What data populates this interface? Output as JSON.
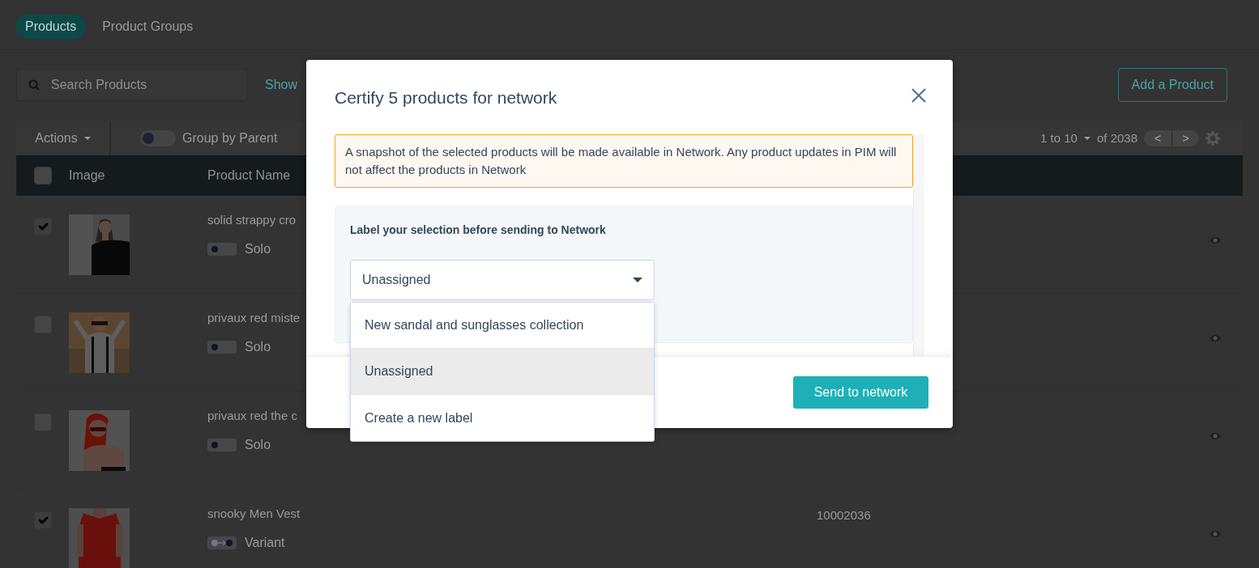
{
  "tabs": [
    {
      "label": "Products",
      "selected": true
    },
    {
      "label": "Product Groups",
      "selected": false
    }
  ],
  "search": {
    "placeholder": "Search Products"
  },
  "show_link": "Show",
  "add_button": "Add a Product",
  "toolbar": {
    "actions": "Actions",
    "group_toggle": {
      "label": "Group by Parent",
      "on": false
    },
    "range": "1 to 10",
    "total": "of 2038",
    "prev": "<",
    "next": ">"
  },
  "table": {
    "header_checked": false,
    "columns": [
      "Image",
      "Product Name"
    ],
    "rows": [
      {
        "checked": true,
        "name": "solid strappy cro",
        "kind": "solo",
        "type": "Solo"
      },
      {
        "checked": false,
        "name": "privaux red miste",
        "kind": "solo",
        "type": "Solo"
      },
      {
        "checked": false,
        "name": "privaux red the c",
        "kind": "solo",
        "type": "Solo"
      },
      {
        "checked": true,
        "name": "snooky Men Vest",
        "kind": "variant",
        "type": "Variant",
        "sku": "10002036"
      }
    ]
  },
  "modal": {
    "title": "Certify 5 products for network",
    "alert": "A snapshot of the selected products will be made available in Network. Any product updates in PIM will not affect the products in Network",
    "label_prompt": "Label your selection before sending to Network",
    "select_value": "Unassigned",
    "options": [
      {
        "label": "New sandal and sunglasses collection",
        "selected": false
      },
      {
        "label": "Unassigned",
        "selected": true
      },
      {
        "label": "Create a new label",
        "selected": false
      }
    ],
    "submit": "Send to network"
  }
}
